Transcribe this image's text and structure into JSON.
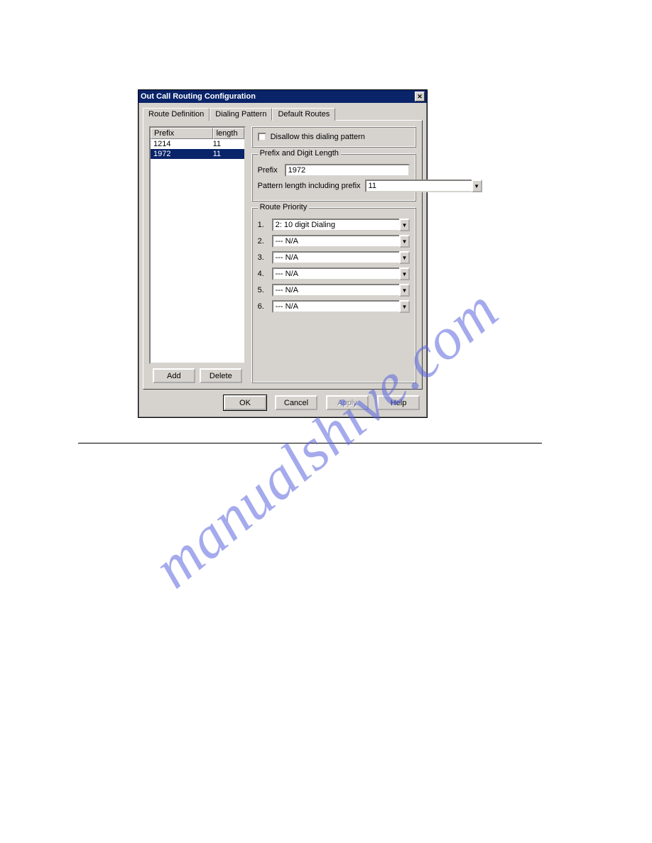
{
  "watermark": "manualshive.com",
  "dialog": {
    "title": "Out Call Routing Configuration",
    "tabs": {
      "route_def": "Route Definition",
      "dialing_pattern": "Dialing Pattern",
      "default_routes": "Default Routes"
    },
    "list": {
      "col_prefix": "Prefix",
      "col_length": "length",
      "rows": [
        {
          "prefix": "1214",
          "length": "11"
        },
        {
          "prefix": "1972",
          "length": "11"
        }
      ]
    },
    "add_btn": "Add",
    "delete_btn": "Delete",
    "disallow_label": "Disallow this dialing pattern",
    "prefix_group": {
      "legend": "Prefix and Digit Length",
      "prefix_label": "Prefix",
      "prefix_value": "1972",
      "pattern_label": "Pattern length including prefix",
      "pattern_value": "11"
    },
    "route_priority": {
      "legend": "Route Priority",
      "rows": [
        {
          "num": "1.",
          "value": "2: 10 digit Dialing"
        },
        {
          "num": "2.",
          "value": "--- N/A"
        },
        {
          "num": "3.",
          "value": "--- N/A"
        },
        {
          "num": "4.",
          "value": "--- N/A"
        },
        {
          "num": "5.",
          "value": "--- N/A"
        },
        {
          "num": "6.",
          "value": "--- N/A"
        }
      ]
    },
    "buttons": {
      "ok": "OK",
      "cancel": "Cancel",
      "apply": "Apply",
      "help": "Help"
    }
  }
}
